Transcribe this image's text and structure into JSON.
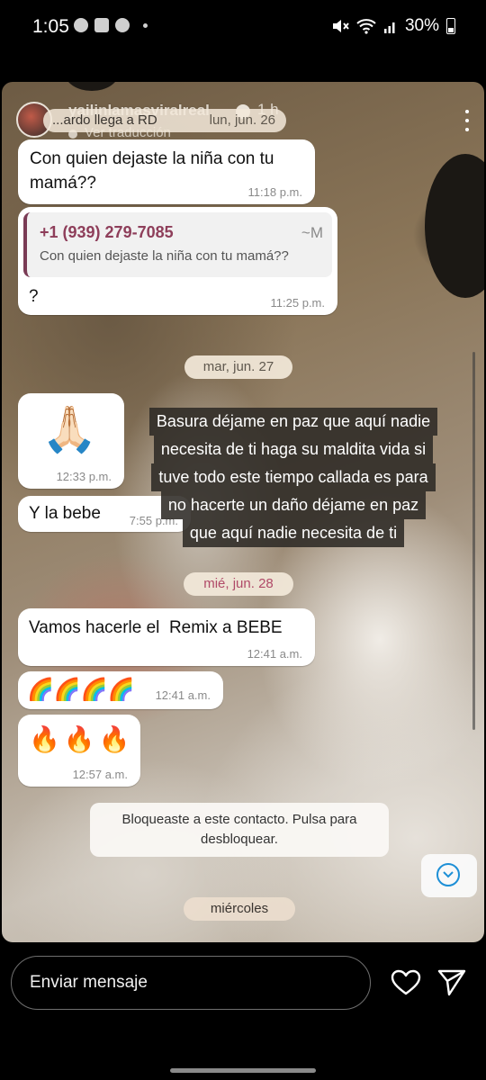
{
  "status_bar": {
    "time": "1:05",
    "notification_icons": [
      "whatsapp-icon",
      "gallery-icon",
      "facebook-icon"
    ],
    "battery": "30%"
  },
  "story": {
    "username": "yailinlamasviralreal",
    "age": "1 h",
    "translate_label": "Ver traducción"
  },
  "chat": {
    "top_fragment": "...ardo llega a RD",
    "date_top": "lun, jun. 26",
    "msg1": {
      "text": "Con quien dejaste la niña con tu mamá??",
      "time": "11:18 p.m."
    },
    "reply_msg": {
      "quoted_name": "+1 (939) 279-7085",
      "quoted_marker": "~M",
      "quoted_text": "Con quien dejaste la niña con tu mamá??",
      "text": "?",
      "time": "11:25 p.m."
    },
    "date_tue": "mar, jun. 27",
    "pray_msg": {
      "emoji": "🙏🏻",
      "time": "12:33 p.m."
    },
    "bebe_msg": {
      "text": "Y la bebe",
      "time": "7:55 p.m."
    },
    "date_wed": "mié, jun. 28",
    "remix_msg": {
      "text": "Vamos hacerle el  Remix a BEBE",
      "time": "12:41 a.m."
    },
    "rainbow_msg": {
      "emoji": "🌈🌈🌈🌈",
      "time": "12:41 a.m."
    },
    "fire_msg": {
      "emoji": "🔥🔥🔥",
      "time": "12:57 a.m."
    },
    "blocked_notice": "Bloqueaste a este contacto. Pulsa para desbloquear.",
    "date_bottom": "miércoles"
  },
  "caption_lines": [
    "Basura déjame en paz que aquí nadie",
    "necesita de ti haga su maldita vida si",
    "tuve todo este tiempo callada es para",
    "no hacerte un daño déjame en paz",
    "que aquí nadie necesita de ti"
  ],
  "reply_bar": {
    "placeholder": "Enviar mensaje",
    "icons": [
      "heart-icon",
      "send-icon"
    ]
  },
  "colors": {
    "quote_name": "#8e3e5a",
    "date_chip_pink_text": "#b04a68",
    "scroll_down_accent": "#1d8fd6"
  }
}
